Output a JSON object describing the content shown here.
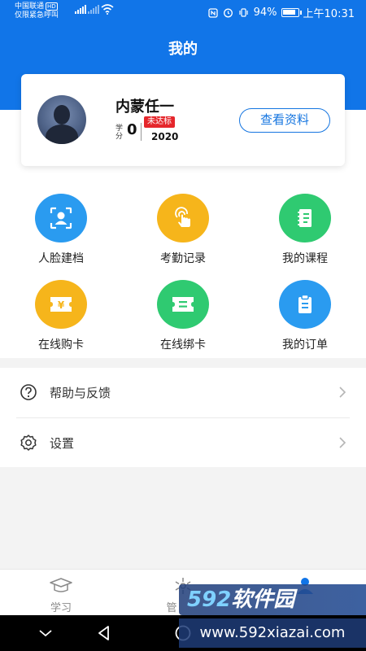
{
  "statusbar": {
    "carrier_line1": "中国联通",
    "carrier_hd": "HD",
    "carrier_line2": "仅限紧急呼叫",
    "battery_pct": "94%",
    "time": "上午10:31"
  },
  "header": {
    "title": "我的"
  },
  "profile": {
    "name": "内蒙任一",
    "credit_label": "学分",
    "credit_value": "0",
    "badge": "未达标",
    "year": "2020",
    "view_button": "查看资料"
  },
  "grid": [
    {
      "label": "人脸建档",
      "icon": "face-scan-icon",
      "color": "#2a9bf0"
    },
    {
      "label": "考勤记录",
      "icon": "touch-icon",
      "color": "#f6b51b"
    },
    {
      "label": "我的课程",
      "icon": "notebook-icon",
      "color": "#2fca71"
    },
    {
      "label": "在线购卡",
      "icon": "yuan-ticket-icon",
      "color": "#f6b51b"
    },
    {
      "label": "在线绑卡",
      "icon": "ticket-icon",
      "color": "#2fca71"
    },
    {
      "label": "我的订单",
      "icon": "clipboard-icon",
      "color": "#2a9bf0"
    }
  ],
  "menu": [
    {
      "label": "帮助与反馈",
      "icon": "help-icon"
    },
    {
      "label": "设置",
      "icon": "settings-icon"
    }
  ],
  "bottom_nav": [
    {
      "label": "学习",
      "icon": "graduation-cap-icon"
    },
    {
      "label": "管",
      "icon": "manage-icon"
    },
    {
      "label": "",
      "icon": "person-icon"
    }
  ],
  "watermark": {
    "text_num": "592",
    "text_cn": "软件园",
    "sub": "www.592xiazai.com"
  },
  "colors": {
    "primary": "#1175e8",
    "badge": "#e5262b",
    "blue_icon": "#2a9bf0",
    "yellow_icon": "#f6b51b",
    "green_icon": "#2fca71"
  }
}
